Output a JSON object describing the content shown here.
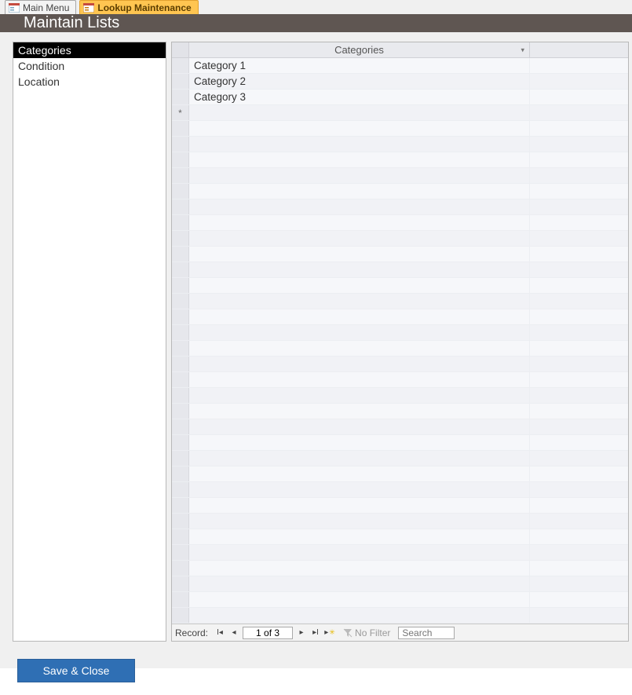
{
  "tabs": {
    "main_menu": "Main Menu",
    "lookup_maintenance": "Lookup Maintenance"
  },
  "header": {
    "title": "Maintain Lists"
  },
  "sidebar": {
    "items": [
      {
        "label": "Categories",
        "selected": true
      },
      {
        "label": "Condition",
        "selected": false
      },
      {
        "label": "Location",
        "selected": false
      }
    ]
  },
  "datasheet": {
    "column_header": "Categories",
    "rows": [
      {
        "value": "Category 1"
      },
      {
        "value": "Category 2"
      },
      {
        "value": "Category 3"
      }
    ],
    "new_row_marker": "*"
  },
  "record_nav": {
    "label": "Record:",
    "position": "1 of 3",
    "no_filter": "No Filter",
    "search_placeholder": "Search"
  },
  "buttons": {
    "save_close": "Save & Close"
  }
}
